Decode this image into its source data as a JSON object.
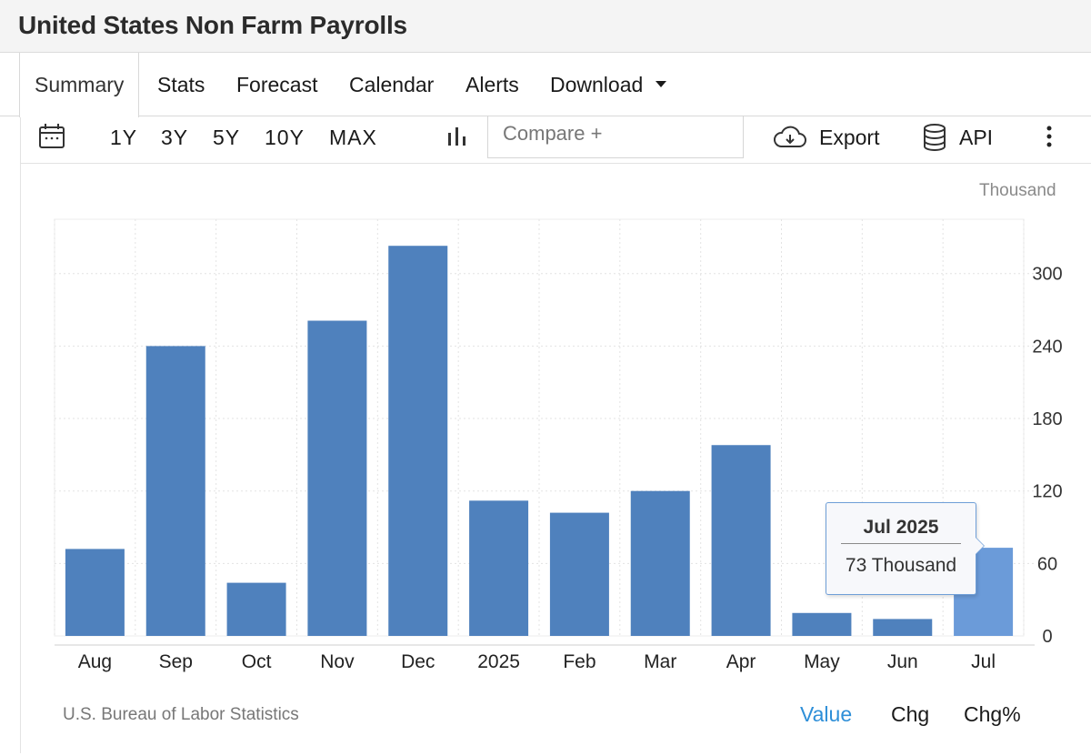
{
  "page": {
    "title": "United States Non Farm Payrolls"
  },
  "tabs": [
    {
      "label": "Summary",
      "active": true
    },
    {
      "label": "Stats"
    },
    {
      "label": "Forecast"
    },
    {
      "label": "Calendar"
    },
    {
      "label": "Alerts"
    },
    {
      "label": "Download"
    }
  ],
  "toolbar": {
    "ranges": [
      "1Y",
      "3Y",
      "5Y",
      "10Y",
      "MAX"
    ],
    "compare_placeholder": "Compare +",
    "export_label": "Export",
    "api_label": "API"
  },
  "tooltip": {
    "title": "Jul 2025",
    "value": "73 Thousand"
  },
  "source": "U.S. Bureau of Labor Statistics",
  "view_modes": [
    {
      "label": "Value",
      "active": true
    },
    {
      "label": "Chg"
    },
    {
      "label": "Chg%"
    }
  ],
  "colors": {
    "bar": "#4f81bd",
    "bar_highlight": "#6b9bd9",
    "accent": "#2e8fd8"
  },
  "chart_data": {
    "type": "bar",
    "unit": "Thousand",
    "categories": [
      "Aug",
      "Sep",
      "Oct",
      "Nov",
      "Dec",
      "2025",
      "Feb",
      "Mar",
      "Apr",
      "May",
      "Jun",
      "Jul"
    ],
    "values": [
      72,
      240,
      44,
      261,
      323,
      112,
      102,
      120,
      158,
      19,
      14,
      73
    ],
    "highlighted_category": "Jul",
    "y_ticks": [
      0,
      60,
      120,
      180,
      240,
      300
    ],
    "ylim": [
      0,
      345
    ],
    "y_axis_side": "right",
    "grid": true
  }
}
